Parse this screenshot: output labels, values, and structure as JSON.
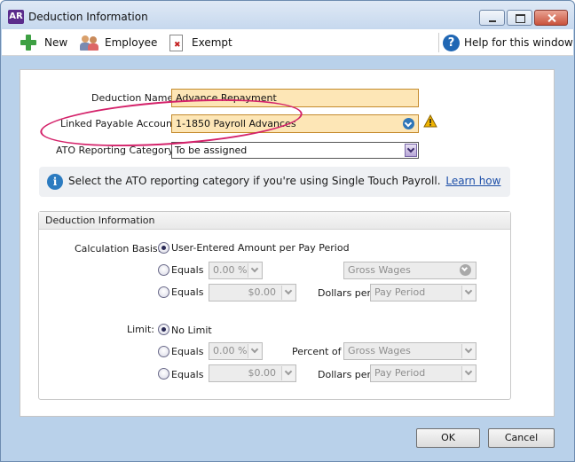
{
  "window": {
    "app_badge": "AR",
    "title": "Deduction Information"
  },
  "toolbar": {
    "new_label": "New",
    "employee_label": "Employee",
    "exempt_label": "Exempt",
    "help_label": "Help for this window",
    "help_glyph": "?"
  },
  "form": {
    "deduction_name_label": "Deduction Name:",
    "deduction_name_value": "Advance Repayment",
    "linked_account_label": "Linked Payable Account:",
    "linked_account_value": "1-1850 Payroll Advances",
    "ato_label": "ATO Reporting Category:",
    "ato_value": "To be assigned"
  },
  "info": {
    "glyph": "i",
    "text": "Select the ATO reporting category if you're using Single Touch Payroll.",
    "link": "Learn how"
  },
  "group": {
    "header": "Deduction Information",
    "calc_label": "Calculation Basis:",
    "calc_option_user": "User-Entered Amount per Pay Period",
    "calc_equals_1": "Equals",
    "calc_percent_1": "0.00 %",
    "calc_percent_of_1": "Gross Wages",
    "calc_equals_2": "Equals",
    "calc_amount_2": "$0.00",
    "calc_dollars_per_label": "Dollars per",
    "calc_pay_period": "Pay Period",
    "limit_label": "Limit:",
    "limit_no_limit": "No Limit",
    "limit_equals_1": "Equals",
    "limit_percent_1": "0.00 %",
    "limit_percent_of_label": "Percent of",
    "limit_percent_of_1": "Gross Wages",
    "limit_equals_2": "Equals",
    "limit_amount_2": "$0.00",
    "limit_dollars_per_label": "Dollars per",
    "limit_pay_period": "Pay Period"
  },
  "footer": {
    "ok_label": "OK",
    "cancel_label": "Cancel"
  },
  "colors": {
    "window_frame": "#b9d1ea",
    "field_fill": "#fde6b6",
    "annotation": "#d4226a",
    "link": "#1d4fa8"
  }
}
